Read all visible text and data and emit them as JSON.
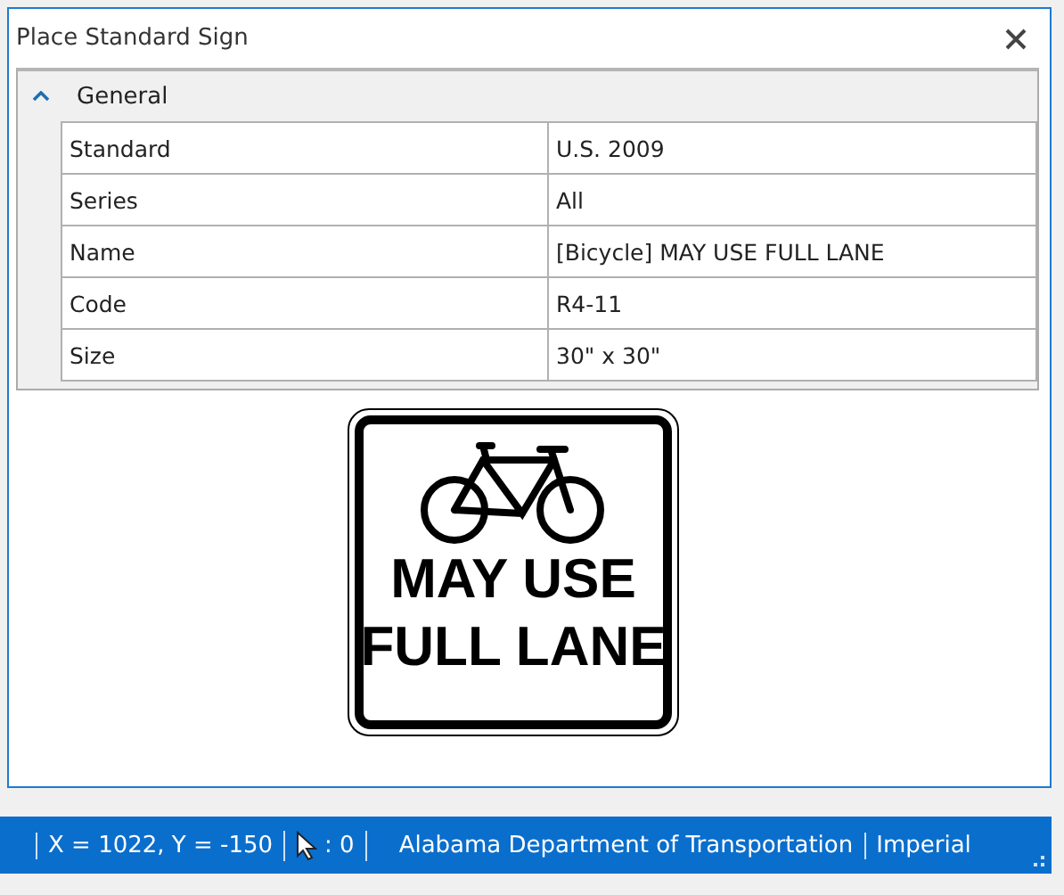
{
  "window": {
    "title": "Place Standard Sign"
  },
  "property_grid": {
    "group": {
      "label": "General",
      "expanded": true
    },
    "rows": [
      {
        "label": "Standard",
        "value": "U.S. 2009"
      },
      {
        "label": "Series",
        "value": "All"
      },
      {
        "label": "Name",
        "value": "[Bicycle] MAY USE FULL LANE"
      },
      {
        "label": "Code",
        "value": "R4-11"
      },
      {
        "label": "Size",
        "value": "30\" x 30\""
      }
    ]
  },
  "sign_preview": {
    "lines": [
      "MAY USE",
      "FULL LANE"
    ]
  },
  "status_bar": {
    "coordinates": "X = 1022, Y = -150",
    "selection_count": ": 0",
    "agency": "Alabama Department of Transportation",
    "units": "Imperial"
  }
}
